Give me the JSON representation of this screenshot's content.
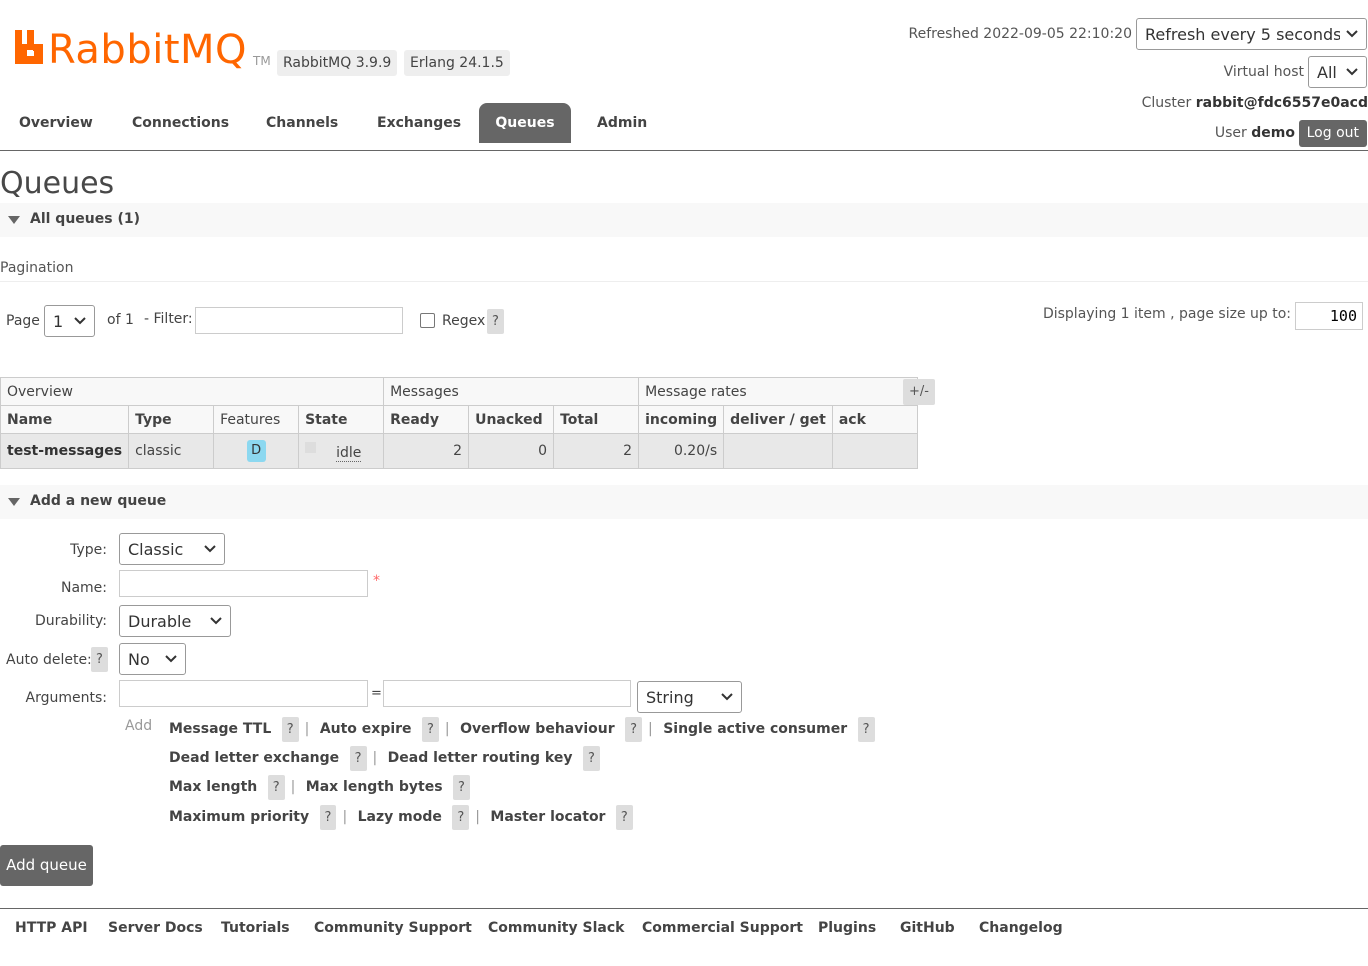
{
  "header": {
    "logo_text": "RabbitMQ",
    "logo_tm": "TM",
    "rabbit_version": "RabbitMQ 3.9.9",
    "erlang_version": "Erlang 24.1.5",
    "refreshed_label": "Refreshed 2022-09-05 22:10:20",
    "refresh_option": "Refresh every 5 seconds",
    "vhost_label": "Virtual host",
    "vhost_value": "All",
    "cluster_label": "Cluster",
    "cluster_value": "rabbit@fdc6557e0acd",
    "user_label": "User",
    "user_value": "demo",
    "logout_label": "Log out"
  },
  "nav": {
    "tabs": [
      "Overview",
      "Connections",
      "Channels",
      "Exchanges",
      "Queues",
      "Admin"
    ],
    "active": "Queues"
  },
  "page": {
    "title": "Queues",
    "all_queues_label": "All queues (1)",
    "pagination_label": "Pagination",
    "page_label": "Page",
    "page_value": "1",
    "of_label": "of 1",
    "filter_label": "- Filter:",
    "filter_value": "",
    "regex_label": "Regex",
    "help_glyph": "?",
    "display_label": "Displaying 1 item , page size up to:",
    "page_size": "100"
  },
  "table": {
    "groups": [
      "Overview",
      "Messages",
      "Message rates"
    ],
    "toggle_label": "+/-",
    "columns": [
      "Name",
      "Type",
      "Features",
      "State",
      "Ready",
      "Unacked",
      "Total",
      "incoming",
      "deliver / get",
      "ack"
    ],
    "rows": [
      {
        "name": "test-messages",
        "type": "classic",
        "features": "D",
        "state": "idle",
        "ready": "2",
        "unacked": "0",
        "total": "2",
        "incoming": "0.20/s",
        "deliver_get": "",
        "ack": ""
      }
    ]
  },
  "add_queue": {
    "section_label": "Add a new queue",
    "type_label": "Type:",
    "type_value": "Classic",
    "name_label": "Name:",
    "name_value": "",
    "required_mark": "*",
    "durability_label": "Durability:",
    "durability_value": "Durable",
    "auto_delete_label": "Auto delete:",
    "auto_delete_value": "No",
    "arguments_label": "Arguments:",
    "arg_key": "",
    "equals": "=",
    "arg_value": "",
    "arg_type": "String",
    "add_label": "Add",
    "arg_links": [
      [
        "Message TTL",
        "Auto expire",
        "Overflow behaviour",
        "Single active consumer"
      ],
      [
        "Dead letter exchange",
        "Dead letter routing key"
      ],
      [
        "Max length",
        "Max length bytes"
      ],
      [
        "Maximum priority",
        "Lazy mode",
        "Master locator"
      ]
    ],
    "separator": "|",
    "submit_label": "Add queue"
  },
  "footer": {
    "links": [
      "HTTP API",
      "Server Docs",
      "Tutorials",
      "Community Support",
      "Community Slack",
      "Commercial Support",
      "Plugins",
      "GitHub",
      "Changelog"
    ]
  },
  "colors": {
    "brand": "#ff6600",
    "nav_active": "#666666",
    "feature_badge": "#8cd8f0"
  }
}
